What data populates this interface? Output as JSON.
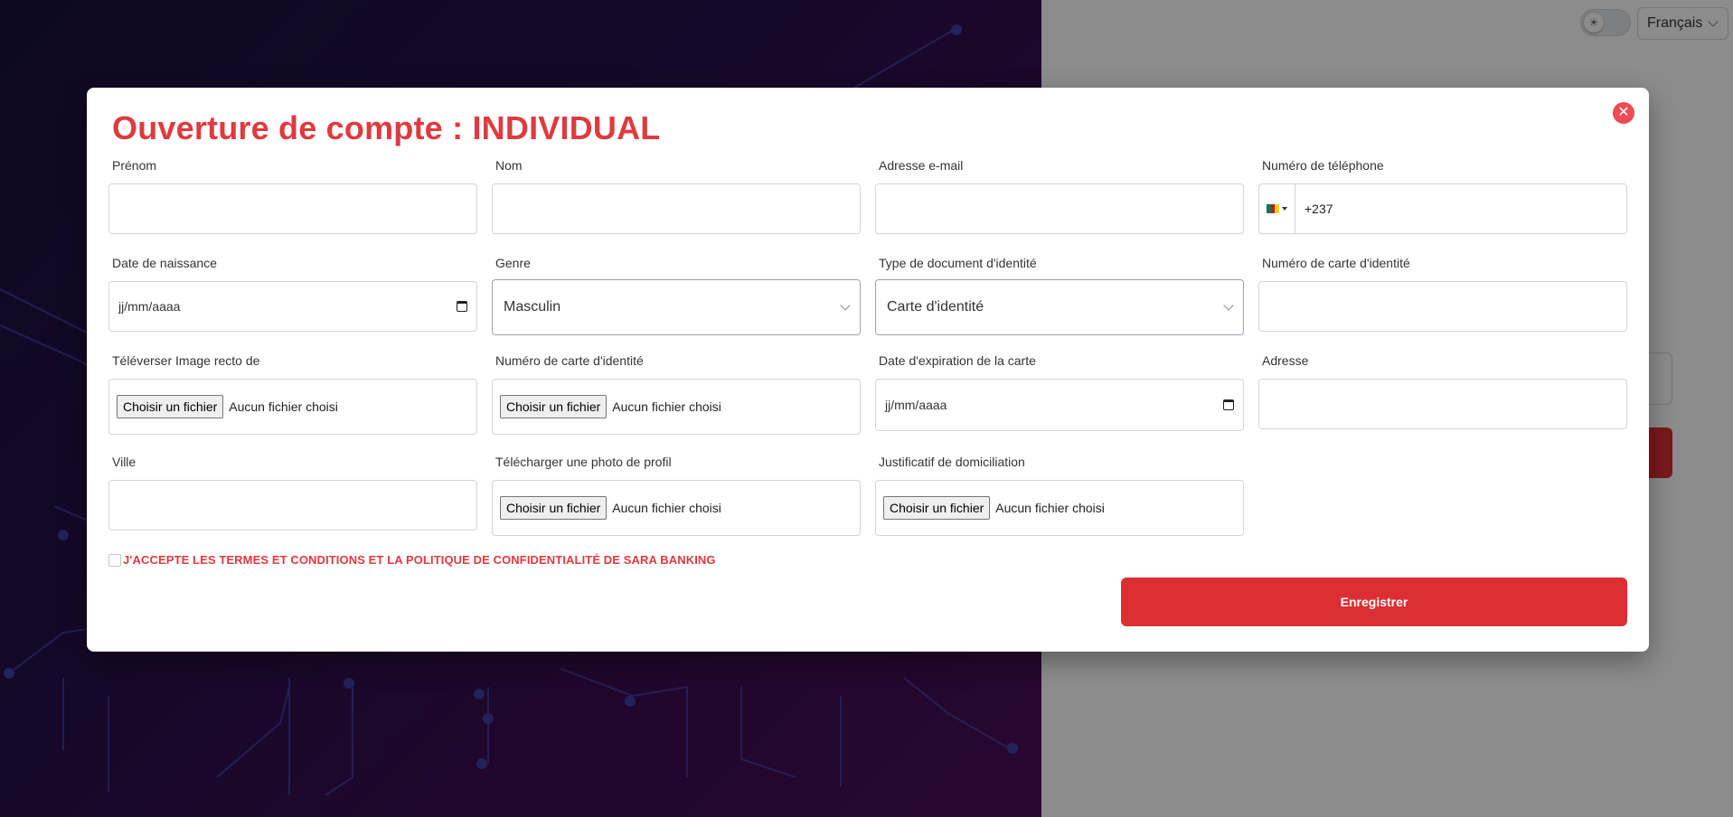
{
  "header": {
    "language": "Français"
  },
  "modal": {
    "title": "Ouverture de compte : INDIVIDUAL",
    "fields": {
      "prenom": {
        "label": "Prénom",
        "value": ""
      },
      "nom": {
        "label": "Nom",
        "value": ""
      },
      "email": {
        "label": "Adresse e-mail",
        "value": ""
      },
      "phone": {
        "label": "Numéro de téléphone",
        "code": "+237"
      },
      "birthdate": {
        "label": "Date de naissance",
        "placeholder": "jj/mm/aaaa"
      },
      "genre": {
        "label": "Genre",
        "value": "Masculin"
      },
      "doc_type": {
        "label": "Type de document d'identité",
        "value": "Carte d'identité"
      },
      "id_number": {
        "label": "Numéro de carte d'identité",
        "value": ""
      },
      "upload_front": {
        "label": "Téléverser Image recto de",
        "button": "Choisir un fichier",
        "status": "Aucun fichier choisi"
      },
      "id_card_upload": {
        "label": "Numéro de carte d'identité",
        "button": "Choisir un fichier",
        "status": "Aucun fichier choisi"
      },
      "expiry": {
        "label": "Date d'expiration de la carte",
        "placeholder": "jj/mm/aaaa"
      },
      "address": {
        "label": "Adresse",
        "value": ""
      },
      "city": {
        "label": "Ville",
        "value": ""
      },
      "profile_photo": {
        "label": "Télécharger une photo de profil",
        "button": "Choisir un fichier",
        "status": "Aucun fichier choisi"
      },
      "proof_address": {
        "label": "Justificatif de domiciliation",
        "button": "Choisir un fichier",
        "status": "Aucun fichier choisi"
      }
    },
    "terms": "J'ACCEPTE LES TERMES ET CONDITIONS ET LA POLITIQUE DE CONFIDENTIALITÉ DE SARA BANKING",
    "submit": "Enregistrer"
  },
  "colors": {
    "accent": "#e03a3e",
    "button": "#dc2f34",
    "flag_green": "#007a5e",
    "flag_red": "#ce1126",
    "flag_yellow": "#fcd116"
  }
}
